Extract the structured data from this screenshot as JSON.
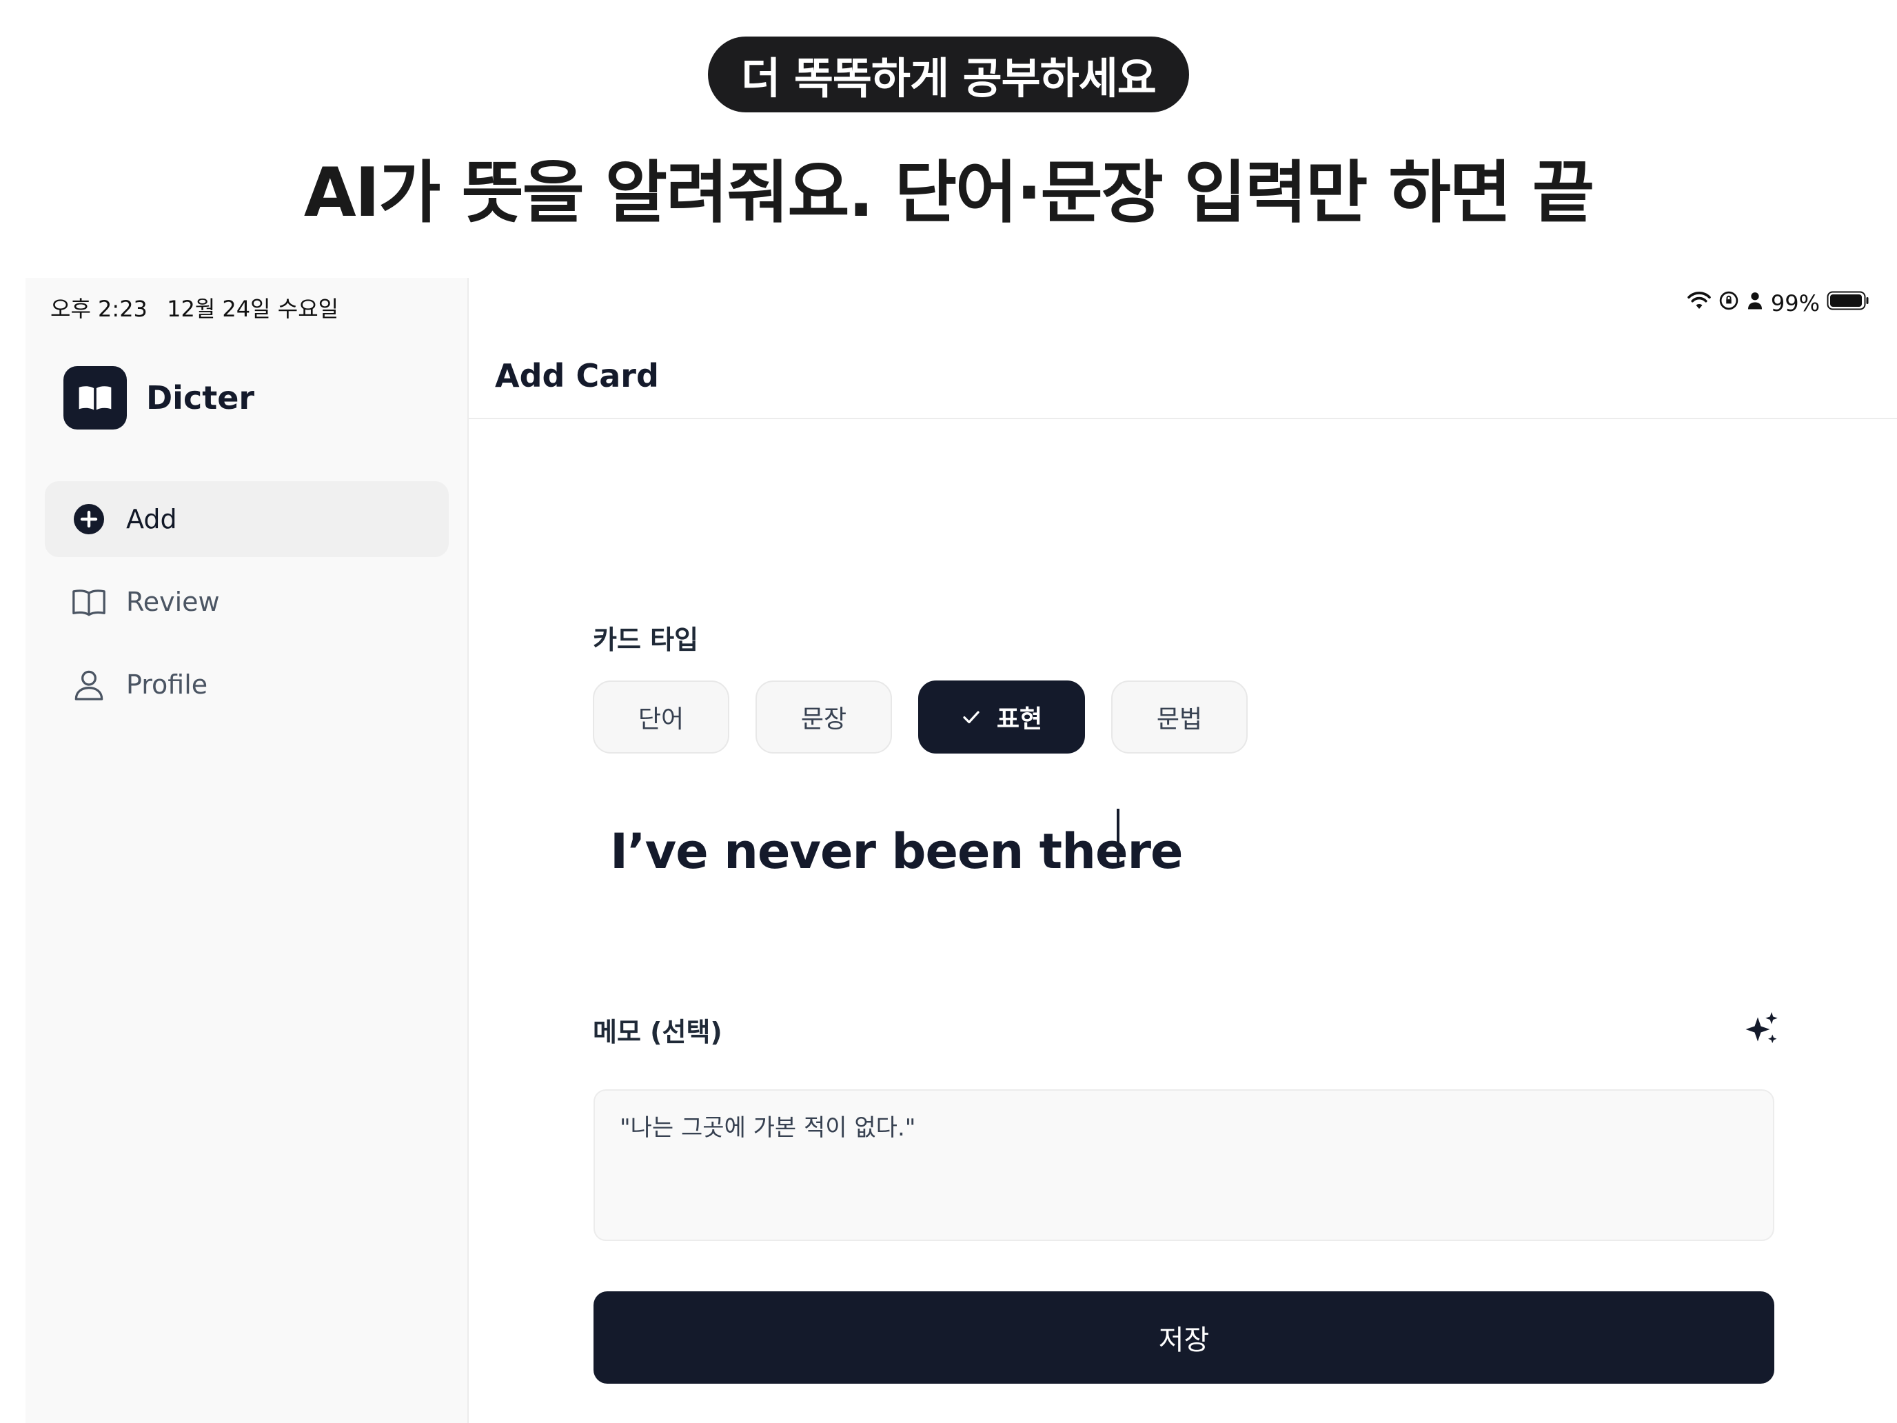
{
  "promo": {
    "pill": "더 똑똑하게 공부하세요",
    "headline": "AI가 뜻을 알려줘요. 단어·문장 입력만 하면 끝"
  },
  "status_bar": {
    "time": "오후 2:23",
    "date": "12월 24일 수요일",
    "battery": "99%",
    "icons": [
      "wifi-icon",
      "orientation-lock-icon",
      "person-icon",
      "battery-icon"
    ]
  },
  "app": {
    "name": "Dicter",
    "logo_icon": "open-book-icon"
  },
  "sidebar": {
    "items": [
      {
        "label": "Add",
        "icon": "plus-circle-icon",
        "active": true
      },
      {
        "label": "Review",
        "icon": "book-icon",
        "active": false
      },
      {
        "label": "Profile",
        "icon": "person-icon",
        "active": false
      }
    ]
  },
  "page": {
    "title": "Add Card"
  },
  "card_type": {
    "label": "카드 타입",
    "options": [
      {
        "label": "단어",
        "selected": false
      },
      {
        "label": "문장",
        "selected": false
      },
      {
        "label": "표현",
        "selected": true
      },
      {
        "label": "문법",
        "selected": false
      }
    ]
  },
  "term": {
    "value": "I’ve never been there"
  },
  "memo": {
    "label": "메모 (선택)",
    "value": "\"나는 그곳에 가본 적이 없다.\"",
    "ai_icon": "sparkles-icon"
  },
  "save": {
    "label": "저장"
  },
  "colors": {
    "primary": "#141a2b",
    "sidebar_bg": "#f9f9f9",
    "chip_bg": "#f7f7f7"
  }
}
